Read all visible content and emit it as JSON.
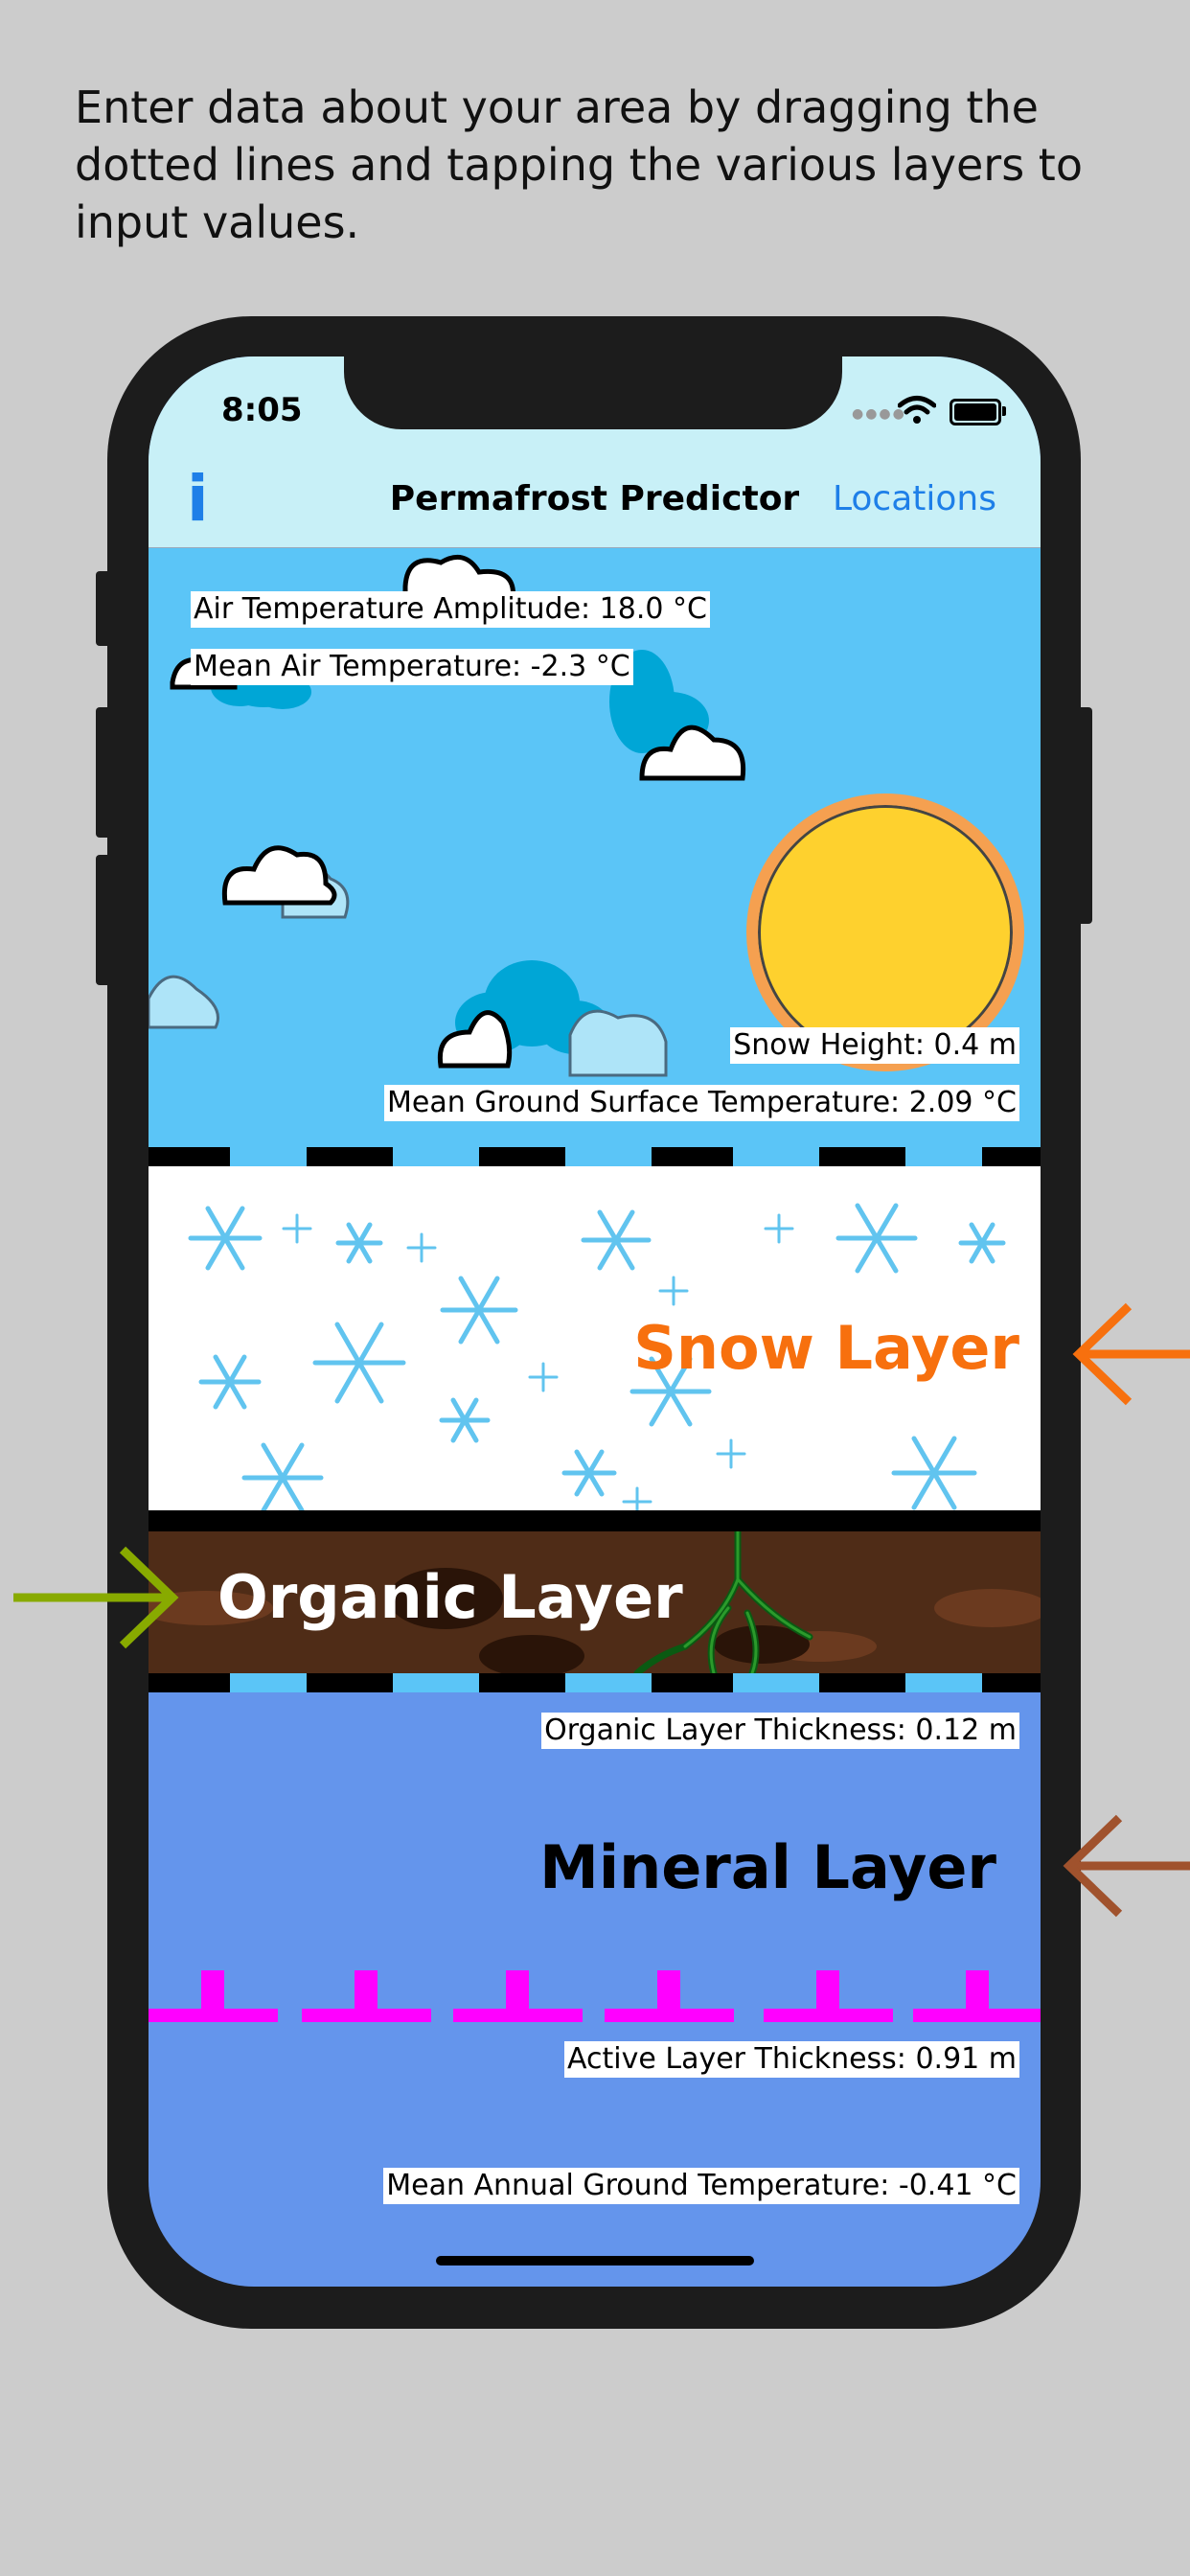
{
  "intro_text": "Enter data about your area by dragging the dotted lines and tapping the various layers to input values.",
  "status": {
    "time": "8:05"
  },
  "nav": {
    "info_label": "i",
    "title": "Permafrost Predictor",
    "locations_label": "Locations"
  },
  "labels": {
    "air_temp_amplitude": "Air Temperature Amplitude: 18.0 °C",
    "mean_air_temp": "Mean Air Temperature: -2.3 °C",
    "snow_height": "Snow Height: 0.4 m",
    "mean_ground_surface_temp": "Mean Ground Surface Temperature: 2.09 °C",
    "organic_thickness": "Organic Layer Thickness: 0.12 m",
    "active_layer_thickness": "Active Layer Thickness: 0.91 m",
    "mean_annual_ground_temp": "Mean Annual Ground Temperature: -0.41 °C"
  },
  "layers": {
    "snow": "Snow Layer",
    "organic": "Organic Layer",
    "mineral": "Mineral Layer"
  },
  "colors": {
    "sky": "#5bc5f7",
    "snow_title": "#f7700e",
    "organic_bg": "#4f2c17",
    "mineral_bg": "#6495ec",
    "active_line": "#ff00ff",
    "sun": "#fed12e",
    "arrow_snow": "#f7700e",
    "arrow_organic": "#88aa00",
    "arrow_mineral": "#a0522d"
  }
}
